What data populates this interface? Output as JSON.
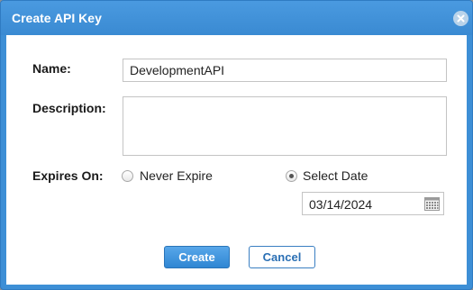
{
  "dialog": {
    "title": "Create API Key",
    "close_icon": "close-icon"
  },
  "form": {
    "name_label": "Name:",
    "name_value": "DevelopmentAPI",
    "description_label": "Description:",
    "description_value": "",
    "expires_label": "Expires On:",
    "expires_options": [
      {
        "label": "Never Expire",
        "checked": false
      },
      {
        "label": "Select Date",
        "checked": true
      }
    ],
    "date_value": "03/14/2024",
    "calendar_icon": "calendar-icon"
  },
  "buttons": {
    "create_label": "Create",
    "cancel_label": "Cancel"
  },
  "colors": {
    "title_bar": "#3d8fd6",
    "primary_button": "#2f86d3",
    "secondary_text": "#2a6fb4"
  }
}
